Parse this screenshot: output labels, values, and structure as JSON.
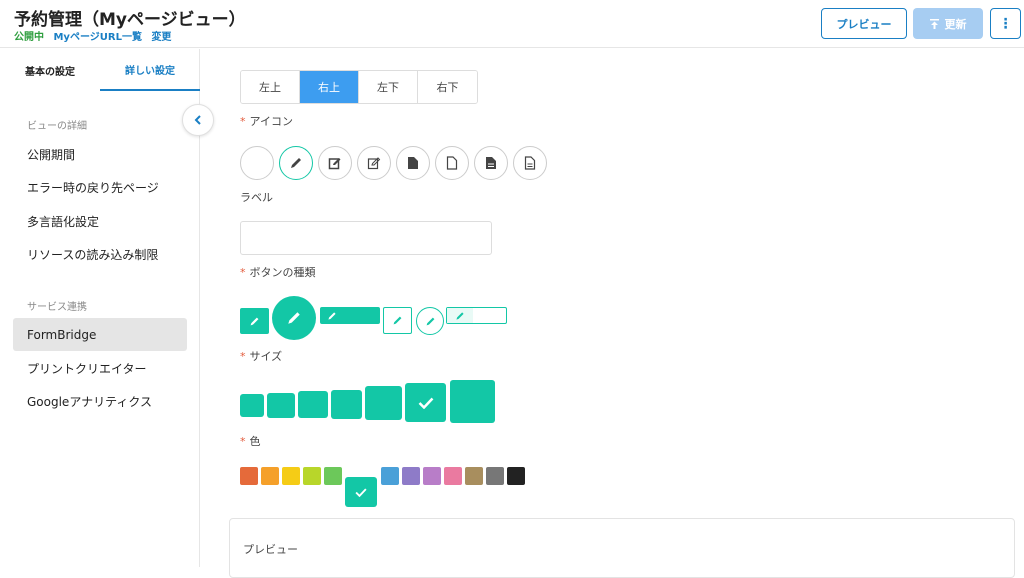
{
  "header": {
    "title": "予約管理（Myページビュー）",
    "status": "公開中",
    "link_list": "MyページURL一覧",
    "link_change": "変更",
    "preview_label": "プレビュー",
    "update_label": "更新",
    "more_label": "⋮"
  },
  "sidebar": {
    "tabs": [
      {
        "label": "基本の設定"
      },
      {
        "label": "詳しい設定"
      }
    ],
    "group1": "ビューの詳細",
    "items1": [
      {
        "label": "公開期間"
      },
      {
        "label": "エラー時の戻り先ページ"
      },
      {
        "label": "多言語化設定"
      },
      {
        "label": "リソースの読み込み制限"
      }
    ],
    "group2": "サービス連携",
    "items2": [
      {
        "label": "FormBridge"
      },
      {
        "label": "プリントクリエイター"
      },
      {
        "label": "Googleアナリティクス"
      }
    ]
  },
  "main": {
    "position_options": [
      {
        "label": "左上"
      },
      {
        "label": "右上"
      },
      {
        "label": "左下"
      },
      {
        "label": "右下"
      }
    ],
    "position_selected": "右上",
    "icon_label": "アイコン",
    "icon_options": [
      "none",
      "pencil-icon",
      "edit-square-icon",
      "edit-square-outline-icon",
      "file-icon",
      "file-outline-icon",
      "file-text-icon",
      "file-text-outline-icon"
    ],
    "label_label": "ラベル",
    "label_value": "",
    "button_type_label": "ボタンの種類",
    "size_label": "サイズ",
    "color_label": "色",
    "colors": [
      "#e56a3a",
      "#f5a02a",
      "#f5cc16",
      "#b8d62a",
      "#6cc85a",
      "#13c7a6",
      "#4aa0d8",
      "#8e7bc8",
      "#b87dc8",
      "#ea7aa0",
      "#a88e5e",
      "#777777",
      "#222222"
    ],
    "color_selected": 5,
    "preview_title": "プレビュー"
  }
}
